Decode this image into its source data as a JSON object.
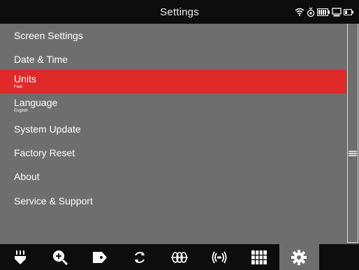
{
  "header": {
    "title": "Settings"
  },
  "status_icons": [
    "wifi-icon",
    "gps-icon",
    "battery-icon",
    "monitor-icon",
    "battery-small-icon"
  ],
  "menu": {
    "items": [
      {
        "label": "Screen Settings",
        "sub": ""
      },
      {
        "label": "Date & Time",
        "sub": ""
      },
      {
        "label": "Units",
        "sub": "Feet"
      },
      {
        "label": "Language",
        "sub": "English"
      },
      {
        "label": "System Update",
        "sub": ""
      },
      {
        "label": "Factory Reset",
        "sub": ""
      },
      {
        "label": "About",
        "sub": ""
      },
      {
        "label": "Service & Support",
        "sub": ""
      }
    ],
    "selected_index": 2
  },
  "toolbar": {
    "items": [
      "probe-icon",
      "zoom-in-icon",
      "tag-icon",
      "rotate-icon",
      "coil-icon",
      "sonde-icon",
      "grid-icon",
      "gear-icon"
    ],
    "active": "gear-icon"
  },
  "colors": {
    "background": "#6e6e6e",
    "bars": "#0d0d0d",
    "selected": "#e02a2a",
    "text": "#ffffff"
  }
}
